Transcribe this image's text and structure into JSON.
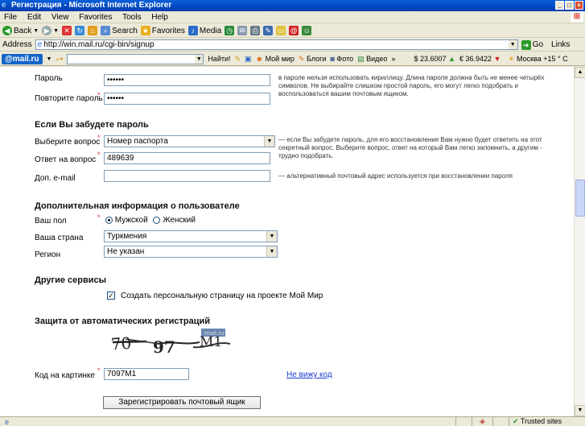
{
  "window": {
    "title": "Регистрация - Microsoft Internet Explorer"
  },
  "menu": [
    "File",
    "Edit",
    "View",
    "Favorites",
    "Tools",
    "Help"
  ],
  "toolbar": {
    "back": "Back",
    "search": "Search",
    "favorites": "Favorites",
    "media": "Media"
  },
  "address": {
    "label": "Address",
    "url": "http://win.mail.ru/cgi-bin/signup",
    "go": "Go",
    "links": "Links"
  },
  "mailbar": {
    "logo": "@mail.ru",
    "find": "Найти!",
    "moi_mir": "Мой мир",
    "blogs": "Блоги",
    "photo": "Фото",
    "video": "Видео",
    "more": "»",
    "usd": "$ 23.6007",
    "eur": "€ 36.9422",
    "weather": "Москва +15 ° C"
  },
  "form": {
    "password_label": "Пароль",
    "password_value": "••••••",
    "password_hint": "в пароле нельзя использовать кириллицу. Длина пароля должна быть не менее четырёх символов. Не выбирайте слишком простой пароль, его могут легко подобрать и воспользоваться вашим почтовым ящиком.",
    "repeat_label": "Повторите пароль",
    "repeat_value": "••••••",
    "forgot_section": "Если Вы забудете пароль",
    "question_label": "Выберите вопрос",
    "question_value": "Номер паспорта",
    "question_hint": "— если Вы забудете пароль, для его восстановления Вам нужно будет ответить на этот секретный вопрос. Выберите вопрос, ответ на который Вам легко запомнить, а другим - трудно подобрать.",
    "answer_label": "Ответ на вопрос",
    "answer_value": "489639",
    "email_label": "Доп. e-mail",
    "email_value": "",
    "email_hint": "— альтернативный почтовый адрес используется при восстановлении пароля",
    "extra_section": "Дополнительная информация о пользователе",
    "gender_label": "Ваш пол",
    "gender_male": "Мужской",
    "gender_female": "Женский",
    "country_label": "Ваша страна",
    "country_value": "Туркмения",
    "region_label": "Регион",
    "region_value": "Не указан",
    "services_section": "Другие сервисы",
    "create_page": "Создать персональную страницу на проекте Мой Мир",
    "captcha_section": "Защита от автоматических регистраций",
    "captcha_label": "Код на картинке",
    "captcha_value": "7097M1",
    "cant_see": "Не вижу код",
    "submit": "Зарегистрировать почтовый ящик"
  },
  "status": {
    "zone": "Trusted sites"
  }
}
